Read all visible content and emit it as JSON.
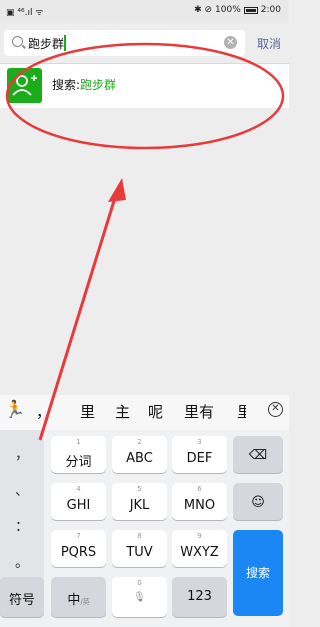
{
  "status_bar": {
    "left": "▣ ⁴⁶.ıl ᯤ",
    "right_icons": "✱ ⊘",
    "battery": "100%",
    "time": "2:00"
  },
  "search": {
    "query": "跑步群",
    "cancel_label": "取消"
  },
  "result": {
    "prefix": "搜索:",
    "keyword": "跑步群"
  },
  "keyboard": {
    "candidates": [
      "，",
      "里",
      "主",
      "呢",
      "里有",
      "里"
    ],
    "punctuation": [
      "，",
      "、",
      "：",
      "。"
    ],
    "rows": [
      [
        {
          "num": "1",
          "label": "分词"
        },
        {
          "num": "2",
          "label": "ABC"
        },
        {
          "num": "3",
          "label": "DEF"
        }
      ],
      [
        {
          "num": "4",
          "label": "GHI"
        },
        {
          "num": "5",
          "label": "JKL"
        },
        {
          "num": "6",
          "label": "MNO"
        }
      ],
      [
        {
          "num": "7",
          "label": "PQRS"
        },
        {
          "num": "8",
          "label": "TUV"
        },
        {
          "num": "9",
          "label": "WXYZ"
        }
      ]
    ],
    "backspace": "⌫",
    "emoji": "☺",
    "send_label": "搜索",
    "symbols_label": "符号",
    "lang_label": "中",
    "lang_sub": "/英",
    "space_num": "0",
    "num_label": "123"
  },
  "colors": {
    "accent": "#1aad19",
    "link": "#576b95",
    "send": "#1a87f5",
    "annotation": "#e83a3a"
  }
}
